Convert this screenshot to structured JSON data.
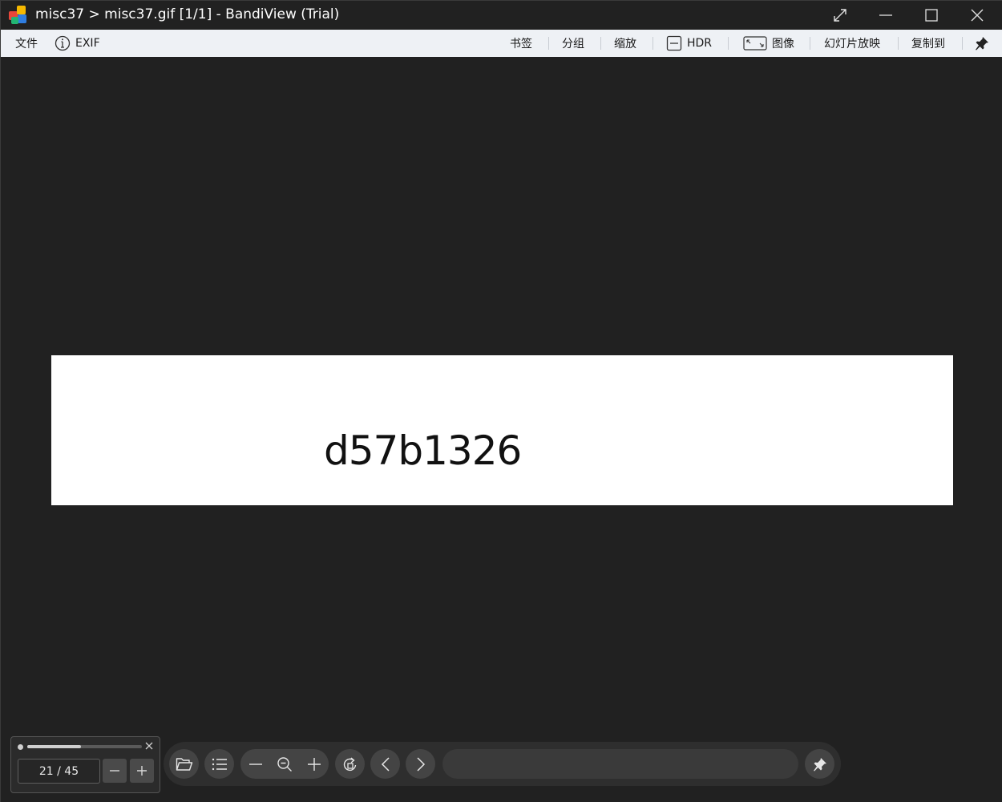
{
  "window": {
    "title": "misc37 > misc37.gif [1/1] - BandiView (Trial)"
  },
  "menu": {
    "file": "文件",
    "exif": "EXIF",
    "bookmark": "书签",
    "group": "分组",
    "zoom": "缩放",
    "hdr": "HDR",
    "image": "图像",
    "slideshow": "幻灯片放映",
    "copy_to": "复制到"
  },
  "image": {
    "text": "d57b1326"
  },
  "page_panel": {
    "page_value": "21 / 45",
    "progress": 0.47
  },
  "colors": {
    "background": "#212121",
    "menubar": "#eef1f5",
    "logo_red": "#e8473a",
    "logo_yellow": "#f5b800",
    "logo_blue": "#2f7de1",
    "logo_green": "#22b573"
  }
}
